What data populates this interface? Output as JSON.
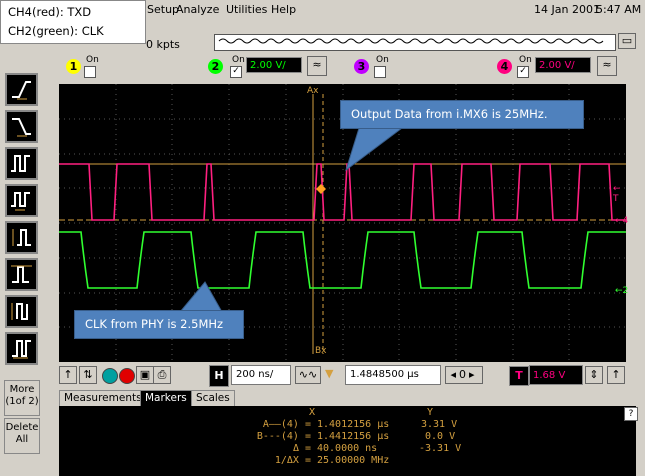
{
  "menu": {
    "items": [
      "Setup",
      "Analyze",
      "Utilities",
      "Help"
    ],
    "date": "14 Jan 2001",
    "time": "5:47 AM"
  },
  "legend": {
    "line1": "CH4(red): TXD",
    "line2": "CH2(green): CLK"
  },
  "acquisition": {
    "memory_partial": "0 kpts"
  },
  "channels": {
    "ch1": {
      "number": "1",
      "on_label": "On",
      "color": "#ffff00"
    },
    "ch2": {
      "number": "2",
      "on_label": "On",
      "value": "2.00 V/",
      "color": "#00ff00"
    },
    "ch3": {
      "number": "3",
      "on_label": "On",
      "color": "#c000ff"
    },
    "ch4": {
      "number": "4",
      "on_label": "On",
      "value": "2.00 V/",
      "color": "#ff0080"
    }
  },
  "left_panel": {
    "more_label": "More\n(1of 2)",
    "delete_label": "Delete\nAll"
  },
  "scope": {
    "marker_ax": "Ax",
    "marker_bx": "Bx",
    "trigger_label": "T",
    "ch4_ref": "4",
    "ch2_ref": "2",
    "annotation_top": "Output Data from i.MX6 is 25MHz.",
    "annotation_bottom": "CLK from PHY is 2.5MHz"
  },
  "bottom_toolbar": {
    "horiz_label": "H",
    "time_per_div": "200 ns/",
    "delay": "1.4848500 µs",
    "trigger_label": "T",
    "trigger_level": "1.68 V"
  },
  "tabs": {
    "items": [
      "Measurements",
      "Markers",
      "Scales"
    ],
    "active": "Markers",
    "help": "?"
  },
  "markers": {
    "header_x": "X",
    "header_y": "Y",
    "rows": [
      {
        "label": "A——(4) =",
        "x": "1.4012156 µs",
        "y": "3.31 V"
      },
      {
        "label": "B---(4) =",
        "x": "1.4412156 µs",
        "y": "0.0 V"
      },
      {
        "label": "Δ =",
        "x": "40.0000 ns",
        "y": "-3.31 V"
      },
      {
        "label": "1/ΔX =",
        "x": "25.00000 MHz",
        "y": ""
      }
    ]
  }
}
